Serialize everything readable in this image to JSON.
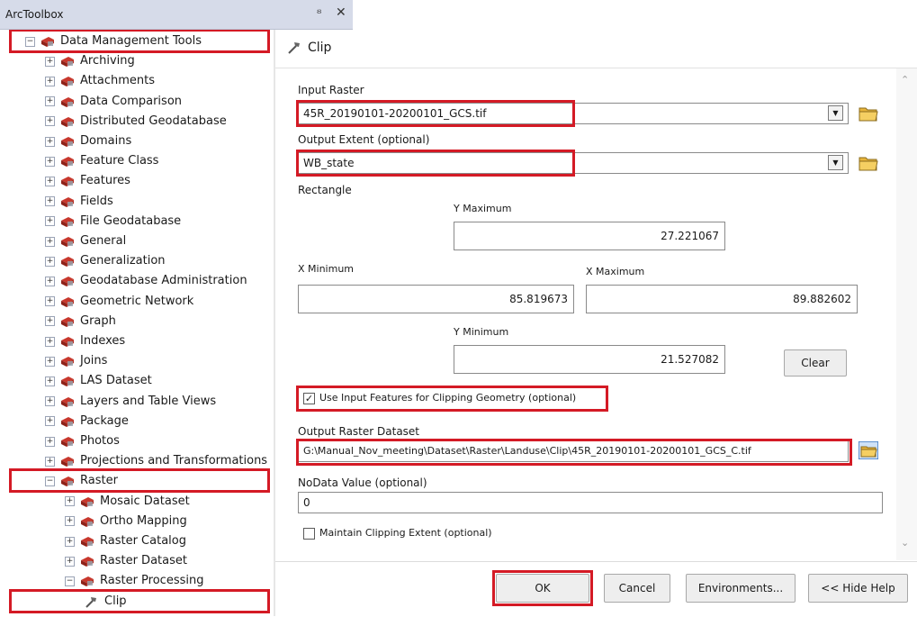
{
  "toolbox": {
    "title": "ArcToolbox",
    "pin": "p",
    "close": "×",
    "tree": [
      {
        "label": "Data Management Tools",
        "level": 0,
        "expanded": true,
        "highlight": true
      },
      {
        "label": "Archiving",
        "level": 1
      },
      {
        "label": "Attachments",
        "level": 1
      },
      {
        "label": "Data Comparison",
        "level": 1
      },
      {
        "label": "Distributed Geodatabase",
        "level": 1
      },
      {
        "label": "Domains",
        "level": 1
      },
      {
        "label": "Feature Class",
        "level": 1
      },
      {
        "label": "Features",
        "level": 1
      },
      {
        "label": "Fields",
        "level": 1
      },
      {
        "label": "File Geodatabase",
        "level": 1
      },
      {
        "label": "General",
        "level": 1
      },
      {
        "label": "Generalization",
        "level": 1
      },
      {
        "label": "Geodatabase Administration",
        "level": 1
      },
      {
        "label": "Geometric Network",
        "level": 1
      },
      {
        "label": "Graph",
        "level": 1
      },
      {
        "label": "Indexes",
        "level": 1
      },
      {
        "label": "Joins",
        "level": 1
      },
      {
        "label": "LAS Dataset",
        "level": 1
      },
      {
        "label": "Layers and Table Views",
        "level": 1
      },
      {
        "label": "Package",
        "level": 1
      },
      {
        "label": "Photos",
        "level": 1
      },
      {
        "label": "Projections and Transformations",
        "level": 1
      },
      {
        "label": "Raster",
        "level": 1,
        "expanded": true,
        "highlight": true
      },
      {
        "label": "Mosaic Dataset",
        "level": 2
      },
      {
        "label": "Ortho Mapping",
        "level": 2
      },
      {
        "label": "Raster Catalog",
        "level": 2
      },
      {
        "label": "Raster Dataset",
        "level": 2
      },
      {
        "label": "Raster Processing",
        "level": 2,
        "expanded": true
      },
      {
        "label": "Clip",
        "level": 3,
        "tool": true,
        "highlight": true
      }
    ]
  },
  "clip": {
    "title": "Clip",
    "input_raster_label": "Input Raster",
    "input_raster_value": "45R_20190101-20200101_GCS.tif",
    "output_extent_label": "Output Extent (optional)",
    "output_extent_value": "WB_state",
    "rectangle_label": "Rectangle",
    "ymax_label": "Y Maximum",
    "ymax_value": "27.221067",
    "xmin_label": "X Minimum",
    "xmin_value": "85.819673",
    "xmax_label": "X Maximum",
    "xmax_value": "89.882602",
    "ymin_label": "Y Minimum",
    "ymin_value": "21.527082",
    "clear_label": "Clear",
    "use_input_features_label": "Use Input Features for Clipping Geometry (optional)",
    "use_input_features_checked": true,
    "output_raster_label": "Output Raster Dataset",
    "output_raster_value": "G:\\Manual_Nov_meeting\\Dataset\\Raster\\Landuse\\Clip\\45R_20190101-20200101_GCS_C.tif",
    "nodata_label": "NoData Value (optional)",
    "nodata_value": "0",
    "maintain_extent_label": "Maintain Clipping Extent (optional)",
    "maintain_extent_checked": false,
    "ok_label": "OK",
    "cancel_label": "Cancel",
    "environments_label": "Environments...",
    "hide_help_label": "<< Hide Help"
  },
  "colors": {
    "highlight": "#d41a25",
    "titlebar": "#d6dbe9",
    "toolbox_red": "#c8382d",
    "folder_yellow": "#e8b43a"
  }
}
